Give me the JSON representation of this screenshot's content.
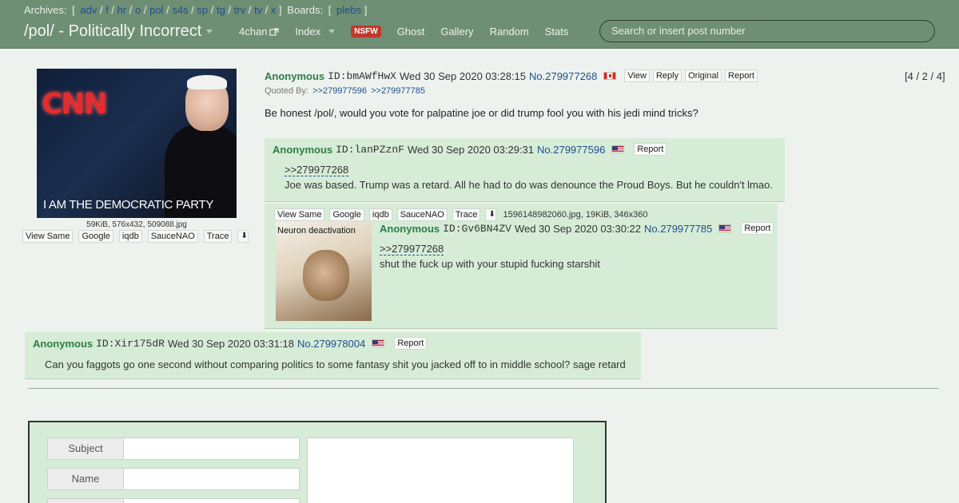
{
  "header": {
    "archives_label": "Archives:",
    "archives": [
      "adv",
      "f",
      "hr",
      "o",
      "pol",
      "s4s",
      "sp",
      "tg",
      "trv",
      "tv",
      "x"
    ],
    "boards_label": "Boards:",
    "boards": [
      "plebs"
    ],
    "board_title": "/pol/ - Politically Incorrect",
    "nav": {
      "fourchan": "4chan",
      "index": "Index",
      "nsfw": "NSFW",
      "ghost": "Ghost",
      "gallery": "Gallery",
      "random": "Random",
      "stats": "Stats"
    },
    "search_placeholder": "Search or insert post number"
  },
  "op": {
    "thumb_caption": "I AM THE DEMOCRATIC PARTY",
    "thumb_logo": "CNN",
    "fileinfo": "59KiB, 576x432, 509088.jpg",
    "tools": [
      "View Same",
      "Google",
      "iqdb",
      "SauceNAO",
      "Trace"
    ],
    "name": "Anonymous",
    "id": "ID:bmAWfHwX",
    "date": "Wed 30 Sep 2020 03:28:15",
    "number": "No.279977268",
    "flag": "ca",
    "actions": [
      "View",
      "Reply",
      "Original",
      "Report"
    ],
    "counts": "[4 / 2 / 4]",
    "quoted_by_label": "Quoted By:",
    "quoted_by": [
      ">>279977596",
      ">>279977785"
    ],
    "body": "Be honest /pol/, would you vote for palpatine joe or did trump fool you with his jedi mind tricks?"
  },
  "replies": [
    {
      "name": "Anonymous",
      "id": "ID:lanPZznF",
      "date": "Wed 30 Sep 2020 03:29:31",
      "number": "No.279977596",
      "flag": "us",
      "report": "Report",
      "quote": ">>279977268",
      "body": "Joe was based. Trump was a retard. All he had to do was denounce the Proud Boys. But he couldn't lmao."
    },
    {
      "tools": [
        "View Same",
        "Google",
        "iqdb",
        "SauceNAO",
        "Trace"
      ],
      "fileinfo": "1596148982060.jpg, 19KiB, 346x360",
      "thumb_caption": "Neuron deactivation",
      "name": "Anonymous",
      "id": "ID:Gv6BN4ZV",
      "date": "Wed 30 Sep 2020 03:30:22",
      "number": "No.279977785",
      "flag": "us",
      "report": "Report",
      "quote": ">>279977268",
      "body": "shut the fuck up with your stupid fucking starshit"
    },
    {
      "name": "Anonymous",
      "id": "ID:Xir175dR",
      "date": "Wed 30 Sep 2020 03:31:18",
      "number": "No.279978004",
      "flag": "us",
      "report": "Report",
      "body": "Can you faggots go one second without comparing politics to some fantasy shit you jacked off to in middle school? sage retard"
    }
  ],
  "form": {
    "subject_label": "Subject",
    "name_label": "Name"
  }
}
